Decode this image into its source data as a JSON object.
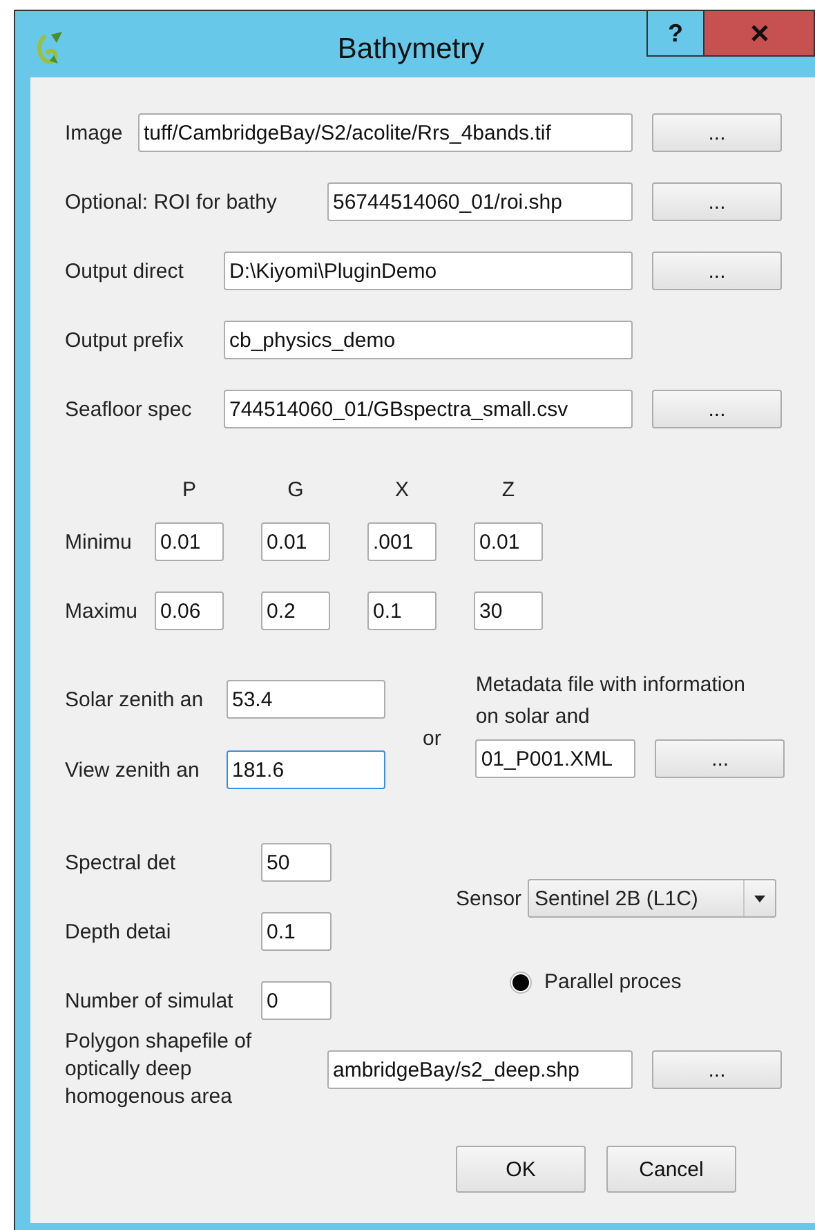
{
  "window": {
    "title": "Bathymetry",
    "help": "?"
  },
  "file_rows": [
    {
      "label": "Image",
      "value": "tuff/CambridgeBay/S2/acolite/Rrs_4bands.tif",
      "browse": "..."
    },
    {
      "label": "Optional: ROI for bathy",
      "value": "56744514060_01/roi.shp",
      "browse": "..."
    },
    {
      "label": "Output direct",
      "value": "D:\\Kiyomi\\PluginDemo",
      "browse": "..."
    },
    {
      "label": "Output prefix",
      "value": "cb_physics_demo"
    },
    {
      "label": "Seafloor spec",
      "value": "744514060_01/GBspectra_small.csv",
      "browse": "..."
    }
  ],
  "parameters": {
    "columns": [
      "P",
      "G",
      "X",
      "Z"
    ],
    "rows": [
      {
        "label": "Minimu",
        "values": [
          "0.01",
          "0.01",
          ".001",
          "0.01"
        ]
      },
      {
        "label": "Maximu",
        "values": [
          "0.06",
          "0.2",
          "0.1",
          "30"
        ]
      }
    ]
  },
  "angles": [
    {
      "label": "Solar zenith an",
      "value": "53.4",
      "focused": false
    },
    {
      "label": "View zenith an",
      "value": "181.6",
      "focused": true
    }
  ],
  "or": "or",
  "metadata": {
    "label": "Metadata file with information on solar and",
    "value": "01_P001.XML",
    "browse": "..."
  },
  "settings": [
    {
      "label": "Spectral det",
      "value": "50"
    },
    {
      "label": "Depth detai",
      "value": "0.1"
    },
    {
      "label": "Number of simulat",
      "value": "0"
    }
  ],
  "sensor": {
    "label": "Sensor",
    "value": "Sentinel 2B (L1C)"
  },
  "parallel": {
    "label": "Parallel proces",
    "checked": true
  },
  "deep_area": {
    "label": "Polygon shapefile of optically deep homogenous area",
    "value": "ambridgeBay/s2_deep.shp",
    "browse": "..."
  },
  "buttons": [
    "OK",
    "Cancel"
  ]
}
